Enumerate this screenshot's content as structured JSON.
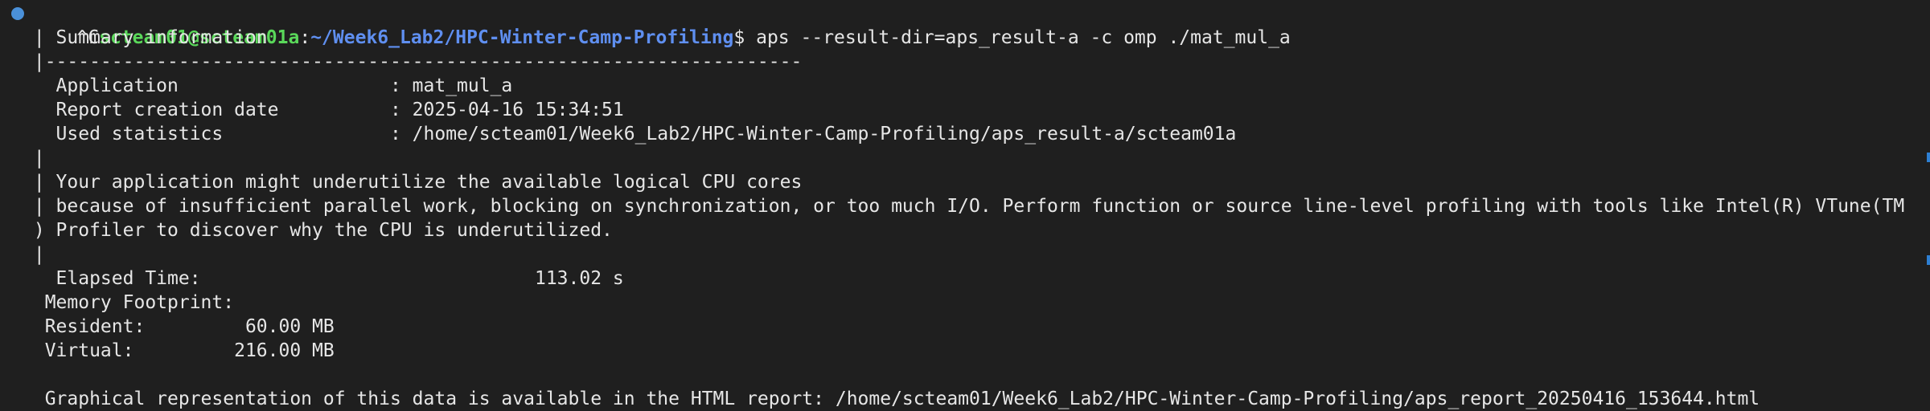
{
  "prompt": {
    "ctrl_c": "^C",
    "user_host": "scteam01@scteam01a",
    "colon": ":",
    "path": "~/Week6_Lab2/HPC-Winter-Camp-Profiling",
    "dollar": "$",
    "command": " aps --result-dir=aps_result-a -c omp ./mat_mul_a"
  },
  "output": [
    " | Summary information",
    " |--------------------------------------------------------------------",
    "   Application                   : mat_mul_a",
    "   Report creation date          : 2025-04-16 15:34:51",
    "   Used statistics               : /home/scteam01/Week6_Lab2/HPC-Winter-Camp-Profiling/aps_result-a/scteam01a",
    " |",
    " | Your application might underutilize the available logical CPU cores",
    " | because of insufficient parallel work, blocking on synchronization, or too much I/O. Perform function or source line-level profiling with tools like Intel(R) VTune(TM",
    " ) Profiler to discover why the CPU is underutilized.",
    " |",
    "   Elapsed Time:                              113.02 s",
    "  Memory Footprint:",
    "  Resident:         60.00 MB",
    "  Virtual:         216.00 MB",
    "",
    "  Graphical representation of this data is available in the HTML report: /home/scteam01/Week6_Lab2/HPC-Winter-Camp-Profiling/aps_report_20250416_153644.html"
  ]
}
